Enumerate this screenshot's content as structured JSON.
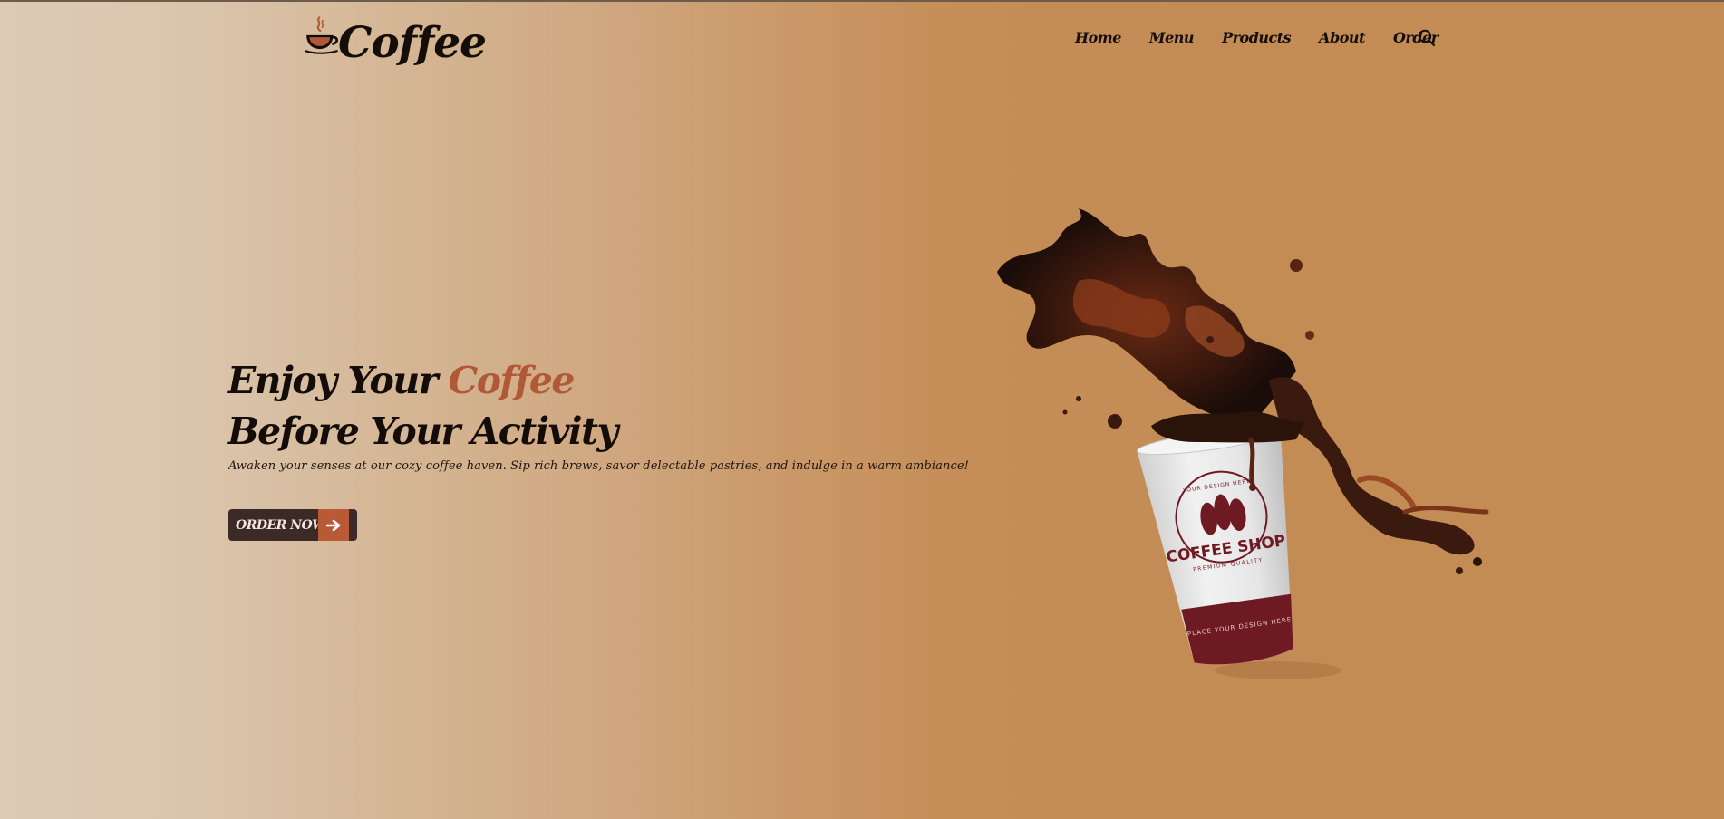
{
  "brand": {
    "name": "Coffee",
    "logo_icon": "coffee-cup-icon"
  },
  "nav": {
    "items": [
      {
        "label": "Home"
      },
      {
        "label": "Menu"
      },
      {
        "label": "Products"
      },
      {
        "label": "About"
      },
      {
        "label": "Order"
      }
    ],
    "search_icon": "search-icon"
  },
  "hero": {
    "title_line1": "Enjoy Your ",
    "title_accent": "Coffee",
    "title_line2": "Before Your Activity",
    "subtitle": "Awaken your senses at our cozy coffee haven. Sip rich brews, savor delectable pastries, and indulge in a warm ambiance!",
    "cta_label": "ORDER NOW",
    "cta_icon": "arrow-right-icon"
  },
  "cup": {
    "brand_text": "COFFEE SHOP",
    "ring_text": "YOUR DESIGN HERE",
    "tagline": "PREMIUM QUALITY",
    "band_text": "PLACE YOUR DESIGN HERE"
  },
  "colors": {
    "accent": "#b15837",
    "button_dark": "#3c2a26",
    "text_dark": "#130c09",
    "background_light": "#ddcbb6",
    "background_warm": "#c48c55"
  }
}
